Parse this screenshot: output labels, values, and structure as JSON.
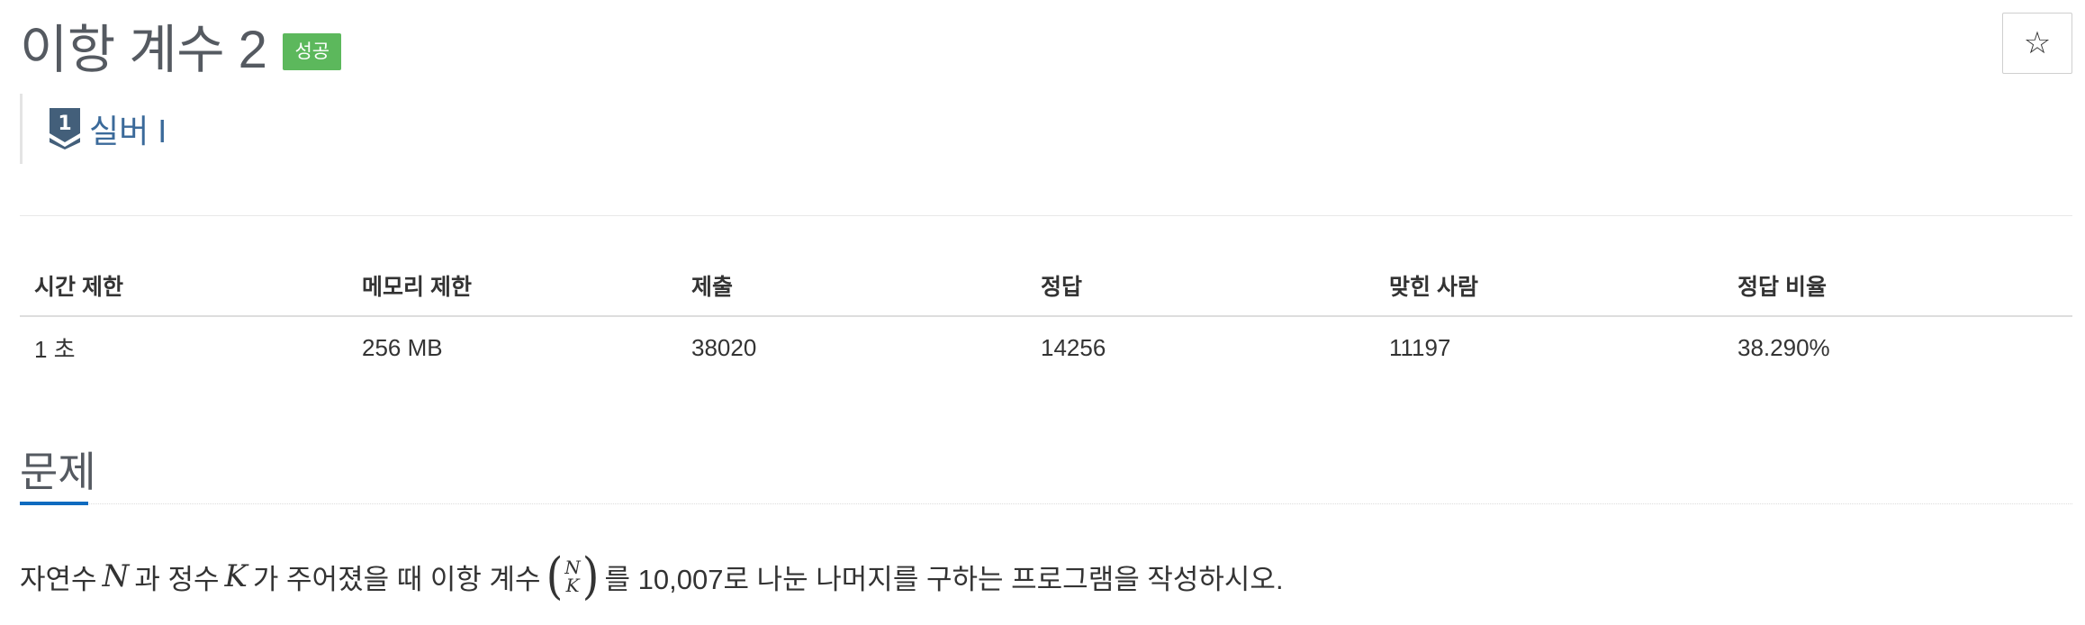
{
  "problem": {
    "title": "이항 계수 2",
    "status_badge": "성공",
    "star_icon": "☆",
    "tier": {
      "icon": "silver-tier-1-icon",
      "icon_number": "1",
      "label": "실버 I",
      "color": "#3b6a9a"
    }
  },
  "stats": {
    "headers": [
      "시간 제한",
      "메모리 제한",
      "제출",
      "정답",
      "맞힌 사람",
      "정답 비율"
    ],
    "values": [
      "1 초",
      "256 MB",
      "38020",
      "14256",
      "11197",
      "38.290%"
    ]
  },
  "section": {
    "title": "문제"
  },
  "statement": {
    "part1": "자연수",
    "var_n": "N",
    "part2": "과 정수",
    "var_k": "K",
    "part3": "가 주어졌을 때 이항 계수",
    "binom_top": "N",
    "binom_bottom": "K",
    "part4": "를 10,007로 나눈 나머지를 구하는 프로그램을 작성하시오."
  },
  "colors": {
    "badge_success": "#5cb85c",
    "accent_blue": "#0f6bbf",
    "tier_silver": "#3b6a9a"
  }
}
